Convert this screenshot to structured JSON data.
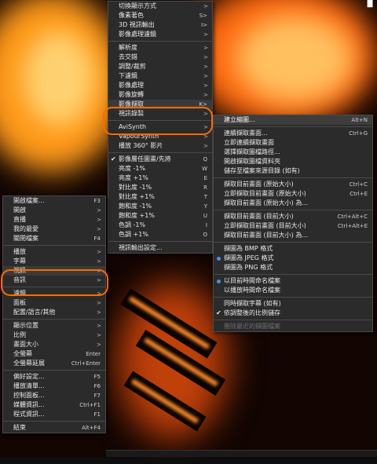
{
  "main_menu": [
    {
      "label": "切換顯示方式",
      "accel": "",
      "submenu": true
    },
    {
      "label": "像素著色",
      "accel": "S>",
      "submenu": false
    },
    {
      "label": "3D 視訊輸出",
      "accel": "I>",
      "submenu": false
    },
    {
      "label": "影像處理濾鏡",
      "accel": "",
      "submenu": true
    },
    {
      "sep": true
    },
    {
      "label": "解析度",
      "accel": "",
      "submenu": true
    },
    {
      "label": "去交錯",
      "accel": "",
      "submenu": true
    },
    {
      "label": "調整/裁剪",
      "accel": "",
      "submenu": true
    },
    {
      "label": "下濾鏡",
      "accel": "",
      "submenu": true
    },
    {
      "label": "影像處理",
      "accel": "",
      "submenu": true
    },
    {
      "label": "影像旋轉",
      "accel": "",
      "submenu": true
    },
    {
      "label": "影像擷取",
      "accel": "K>",
      "submenu": false,
      "highlight": true
    },
    {
      "label": "視訊錄製",
      "accel": "",
      "submenu": true
    },
    {
      "sep": true
    },
    {
      "label": "AviSynth",
      "accel": "",
      "submenu": true
    },
    {
      "label": "VapourSynth",
      "accel": "",
      "submenu": true
    },
    {
      "label": "播放 360° 影片",
      "accel": "",
      "submenu": true
    },
    {
      "sep": true
    },
    {
      "label": "影像層任圖畫/先將",
      "accel": "Q",
      "check": true
    },
    {
      "label": "亮度 -1%",
      "accel": "W"
    },
    {
      "label": "亮度 +1%",
      "accel": "E"
    },
    {
      "label": "對比度 -1%",
      "accel": "R"
    },
    {
      "label": "對比度 +1%",
      "accel": "T"
    },
    {
      "label": "飽和度 -1%",
      "accel": "Y"
    },
    {
      "label": "飽和度 +1%",
      "accel": "U"
    },
    {
      "label": "色調 -1%",
      "accel": "I"
    },
    {
      "label": "色調 +1%",
      "accel": "O"
    },
    {
      "sep": true
    },
    {
      "label": "視訊輸出設定...",
      "accel": ""
    }
  ],
  "capture_menu": [
    {
      "label": "建立縮圖...",
      "accel": "Alt+N",
      "selected": true
    },
    {
      "sep": true
    },
    {
      "label": "連續擷取畫面...",
      "accel": "Ctrl+G"
    },
    {
      "label": "立即連續擷取畫面",
      "accel": ""
    },
    {
      "label": "選擇擷取圖檔路徑...",
      "accel": ""
    },
    {
      "label": "開啟擷取圖檔資料夾",
      "accel": ""
    },
    {
      "label": "儲存至檔案來源目錄 (如有)",
      "accel": ""
    },
    {
      "sep": true
    },
    {
      "label": "擷取目前畫面 (原始大小)",
      "accel": "Ctrl+C"
    },
    {
      "label": "立即擷取目前畫面 (原始大小)",
      "accel": "Ctrl+E"
    },
    {
      "label": "擷取目前畫面 (原始大小) 為...",
      "accel": ""
    },
    {
      "sep": true
    },
    {
      "label": "擷取目前畫面 (目前大小)",
      "accel": "Ctrl+Alt+C"
    },
    {
      "label": "立即擷取目前畫面 (目前大小)",
      "accel": "Ctrl+Alt+E"
    },
    {
      "label": "擷取目前畫面 (目前大小) 為...",
      "accel": ""
    },
    {
      "sep": true
    },
    {
      "label": "擷圖為 BMP 格式",
      "accel": ""
    },
    {
      "label": "擷圖為 JPEG 格式",
      "accel": "",
      "radio": true
    },
    {
      "label": "擷圖為 PNG 格式",
      "accel": ""
    },
    {
      "sep": true
    },
    {
      "label": "以目前時間命名檔案",
      "accel": "",
      "radio": true
    },
    {
      "label": "以播放時間命名檔案",
      "accel": ""
    },
    {
      "sep": true
    },
    {
      "label": "同時擷取字幕 (如有)",
      "accel": ""
    },
    {
      "label": "依調整後的比例儲存",
      "accel": "",
      "check": true
    },
    {
      "sep": true
    },
    {
      "label": "刪除最近的擷圖檔案",
      "accel": "",
      "disabled": true
    }
  ],
  "context_menu": [
    {
      "label": "開啟檔案...",
      "accel": "F3"
    },
    {
      "label": "開啟",
      "accel": "",
      "submenu": true
    },
    {
      "label": "直播",
      "accel": "",
      "submenu": true
    },
    {
      "label": "我的最愛",
      "accel": "",
      "submenu": true
    },
    {
      "label": "關閉檔案",
      "accel": "F4"
    },
    {
      "sep": true
    },
    {
      "label": "播放",
      "accel": "",
      "submenu": true
    },
    {
      "label": "字幕",
      "accel": "",
      "submenu": true
    },
    {
      "label": "視訊",
      "accel": "",
      "submenu": true,
      "highlight": true
    },
    {
      "label": "音訊",
      "accel": "",
      "submenu": true
    },
    {
      "sep": true
    },
    {
      "label": "濾鏡",
      "accel": "",
      "submenu": true
    },
    {
      "label": "面板",
      "accel": "",
      "submenu": true
    },
    {
      "label": "配置/語言/其他",
      "accel": "",
      "submenu": true
    },
    {
      "sep": true
    },
    {
      "label": "顯示位置",
      "accel": "",
      "submenu": true
    },
    {
      "label": "比例",
      "accel": "",
      "submenu": true
    },
    {
      "label": "畫面大小",
      "accel": "",
      "submenu": true
    },
    {
      "label": "全螢幕",
      "accel": "Enter"
    },
    {
      "label": "全螢幕延展",
      "accel": "Ctrl+Enter"
    },
    {
      "sep": true
    },
    {
      "label": "偏好設定...",
      "accel": "F5"
    },
    {
      "label": "播放清單...",
      "accel": "F6"
    },
    {
      "label": "控制面板...",
      "accel": "F7"
    },
    {
      "label": "媒體資訊...",
      "accel": "Ctrl+F1"
    },
    {
      "label": "程式資訊...",
      "accel": "F1"
    },
    {
      "sep": true
    },
    {
      "label": "結束",
      "accel": "Alt+F4"
    }
  ],
  "colors": {
    "annotation": "#ff6a00",
    "menu_bg": "#2b2b2b",
    "radio": "#4a90e2"
  },
  "icons": {
    "top_right": "window-icon"
  }
}
